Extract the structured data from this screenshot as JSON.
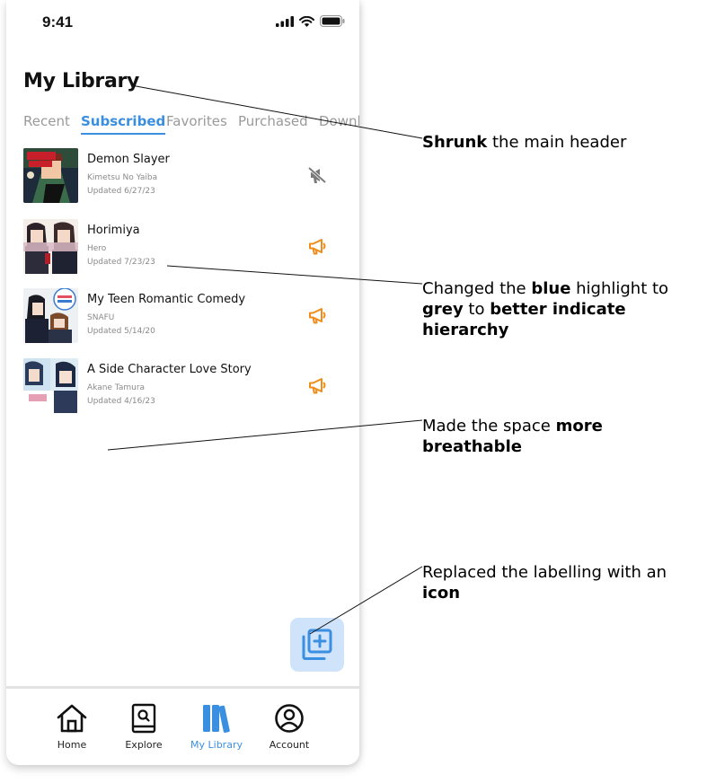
{
  "status": {
    "time": "9:41"
  },
  "header": {
    "title": "My Library"
  },
  "tabs": [
    {
      "label": "Recent"
    },
    {
      "label": "Subscribed"
    },
    {
      "label": "Favorites"
    },
    {
      "label": "Purchased"
    },
    {
      "label": "Downl"
    }
  ],
  "library": [
    {
      "title": "Demon Slayer",
      "author": "Kimetsu No Yaiba",
      "updated": "Updated 6/27/23",
      "action_icon": "muted-megaphone-icon"
    },
    {
      "title": "Horimiya",
      "author": "Hero",
      "updated": "Updated 7/23/23",
      "action_icon": "megaphone-icon"
    },
    {
      "title": "My Teen Romantic Comedy",
      "author": "SNAFU",
      "updated": "Updated 5/14/20",
      "action_icon": "megaphone-icon"
    },
    {
      "title": "A Side Character Love Story",
      "author": "Akane Tamura",
      "updated": "Updated 4/16/23",
      "action_icon": "megaphone-icon"
    }
  ],
  "fab": {
    "icon": "add-to-library-icon"
  },
  "nav": [
    {
      "label": "Home",
      "icon": "home-icon"
    },
    {
      "label": "Explore",
      "icon": "explore-icon"
    },
    {
      "label": "My Library",
      "icon": "library-icon"
    },
    {
      "label": "Account",
      "icon": "account-icon"
    }
  ],
  "annotations": {
    "header": {
      "bold": "Shrunk",
      "text": " the main header"
    },
    "highlight": {
      "t1": "Changed the ",
      "b1": "blue",
      "t2": " highlight to ",
      "b2": "grey",
      "t3": " to ",
      "b3": "better indicate hierarchy"
    },
    "space": {
      "text": "Made the space ",
      "bold": "more breathable"
    },
    "icon": {
      "text": "Replaced the labelling with an ",
      "bold": "icon"
    }
  },
  "colors": {
    "accent": "#3b8fe0",
    "notify": "#f08c1a",
    "muted": "#7a7a7a",
    "fab_bg": "#cfe3fb"
  }
}
